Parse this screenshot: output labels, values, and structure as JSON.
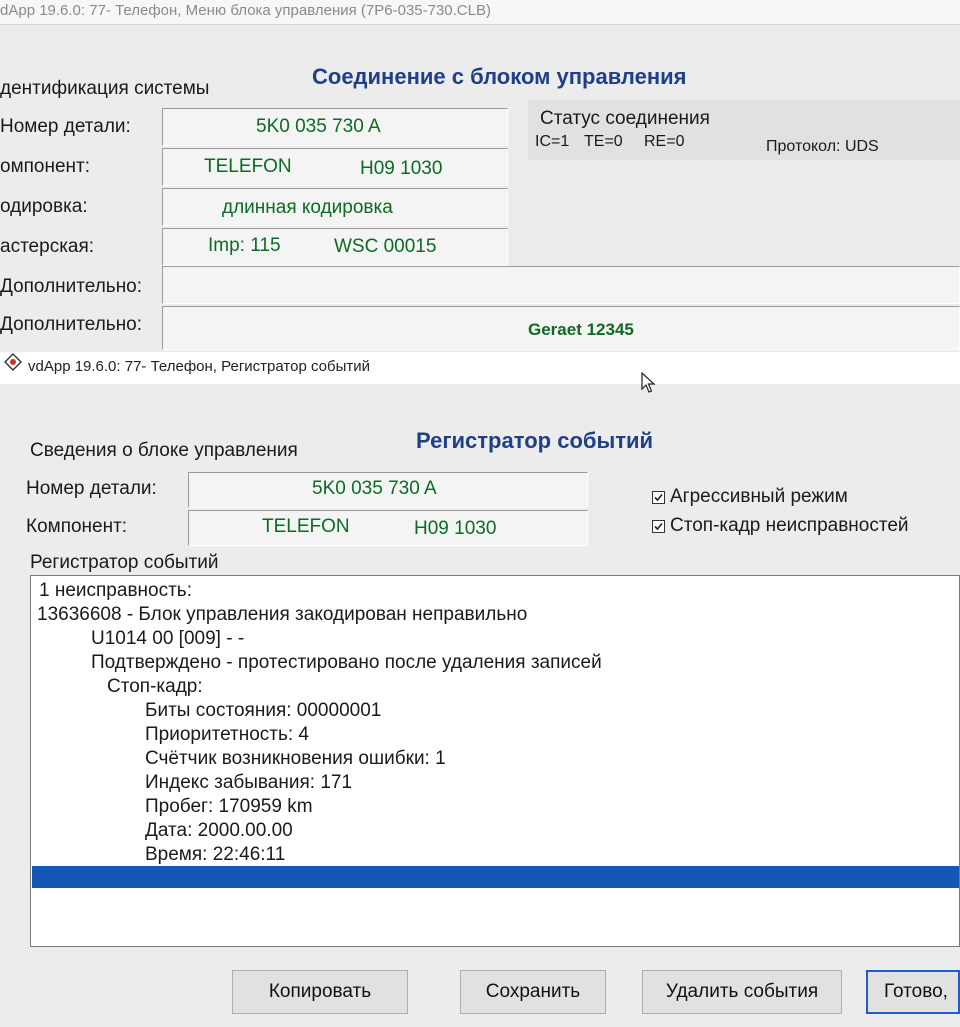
{
  "win1": {
    "title": "dApp 19.6.0: 77- Телефон,  Меню блока управления (7P6-035-730.CLB)",
    "heading": "Соединение с блоком управления",
    "group_title": "дентификация системы",
    "labels": {
      "part": "Номер детали:",
      "component": "омпонент:",
      "coding": "одировка:",
      "workshop": "астерская:",
      "extra1": "Дополнительно:",
      "extra2": "Дополнительно:"
    },
    "values": {
      "part": "5K0 035 730 A",
      "component_name": "TELEFON",
      "component_ver": "H09 1030",
      "coding": "длинная кодировка",
      "workshop_imp": "Imp: 115",
      "workshop_wsc": "WSC 00015",
      "extra1": "",
      "extra2": "Geraet 12345"
    },
    "status": {
      "title": "Статус соединения",
      "ic": "IC=1",
      "te": "TE=0",
      "re": "RE=0",
      "protocol": "Протокол: UDS"
    }
  },
  "win2": {
    "title": "vdApp 19.6.0: 77- Телефон,  Регистратор событий",
    "heading": "Регистратор событий",
    "group_title": "Сведения о блоке управления",
    "labels": {
      "part": "Номер детали:",
      "component": "Компонент:"
    },
    "values": {
      "part": "5K0 035 730 A",
      "component_name": "TELEFON",
      "component_ver": "H09 1030"
    },
    "checkboxes": [
      {
        "label": "Агрессивный режим",
        "checked": true
      },
      {
        "label": "Стоп-кадр неисправностей",
        "checked": true
      }
    ],
    "events_title": "Регистратор событий",
    "events": [
      "1 неисправность:",
      "13636608 - Блок управления закодирован неправильно",
      "U1014 00 [009] - -",
      "Подтверждено - протестировано после удаления записей",
      "Стоп-кадр:",
      "Биты состояния: 00000001",
      "Приоритетность: 4",
      "Счётчик возникновения ошибки: 1",
      "Индекс забывания: 171",
      "Пробег: 170959 km",
      "Дата: 2000.00.00",
      "Время: 22:46:11"
    ],
    "buttons": {
      "copy": "Копировать",
      "save": "Сохранить",
      "delete": "Удалить события",
      "done": "Готово,"
    }
  },
  "colors": {
    "accent_blue": "#1f3f86",
    "value_green": "#0e6a23",
    "selection": "#1557b5"
  }
}
